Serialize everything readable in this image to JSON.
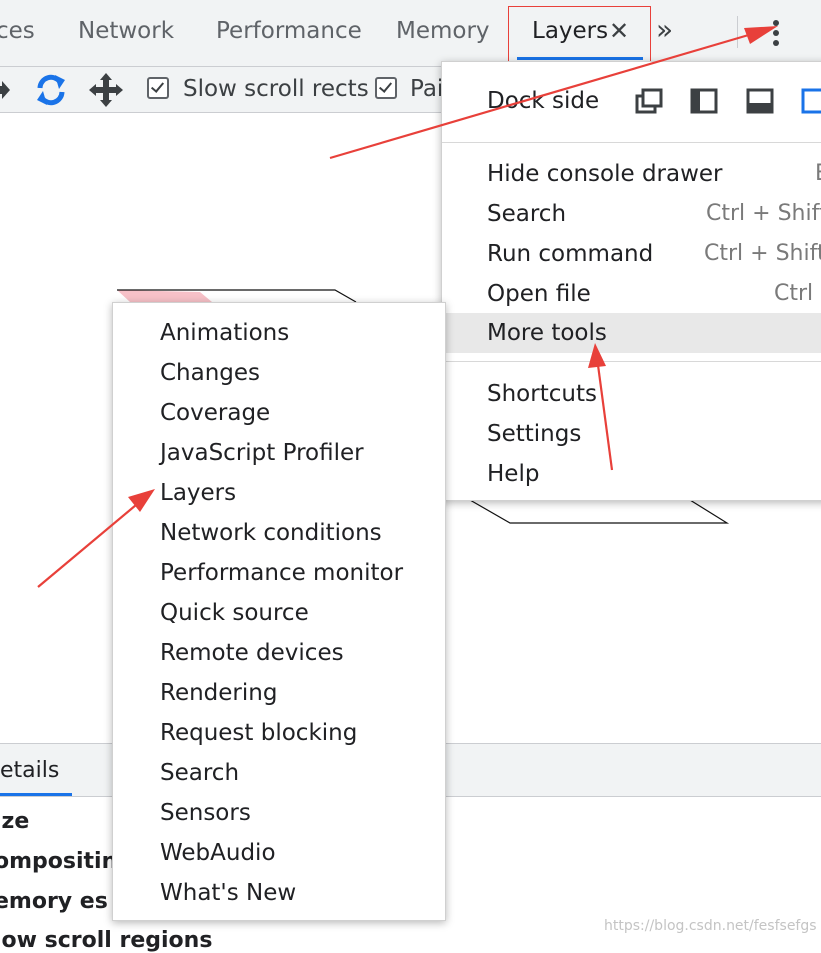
{
  "tabs": [
    {
      "label": "ces",
      "active": false
    },
    {
      "label": "Network",
      "active": false
    },
    {
      "label": "Performance",
      "active": false
    },
    {
      "label": "Memory",
      "active": false
    },
    {
      "label": "Layers",
      "active": true
    }
  ],
  "tab_close_glyph": "✕",
  "tab_overflow_glyph": "»",
  "toolbar": {
    "icons": [
      "pan-arrow-icon",
      "rotate-icon",
      "move-icon"
    ],
    "checkboxes": [
      {
        "label": "Slow scroll rects",
        "checked": true
      },
      {
        "label": "Pai",
        "checked": true
      }
    ]
  },
  "details": {
    "tab_label": "etails",
    "properties": [
      "ize",
      "ompositin",
      "emory es",
      "low scroll regions"
    ]
  },
  "main_menu": {
    "dock_side_label": "Dock side",
    "dock_icons": [
      "undock-icon",
      "dock-left-icon",
      "dock-bottom-icon",
      "dock-right-icon"
    ],
    "items": [
      {
        "label": "Hide console drawer",
        "shortcut": "E"
      },
      {
        "label": "Search",
        "shortcut": "Ctrl + Shift -"
      },
      {
        "label": "Run command",
        "shortcut": "Ctrl + Shift -"
      },
      {
        "label": "Open file",
        "shortcut": "Ctrl -"
      },
      {
        "label": "More tools",
        "shortcut": ""
      },
      {
        "label": "Shortcuts",
        "shortcut": ""
      },
      {
        "label": "Settings",
        "shortcut": ""
      },
      {
        "label": "Help",
        "shortcut": ""
      }
    ]
  },
  "more_tools_menu": {
    "items": [
      "Animations",
      "Changes",
      "Coverage",
      "JavaScript Profiler",
      "Layers",
      "Network conditions",
      "Performance monitor",
      "Quick source",
      "Remote devices",
      "Rendering",
      "Request blocking",
      "Search",
      "Sensors",
      "WebAudio",
      "What's New"
    ]
  },
  "watermark": "https://blog.csdn.net/fesfsefgs",
  "colors": {
    "accent": "#1a73e8",
    "annotation": "#e8403a",
    "menu_hover": "#e8e8e8"
  }
}
